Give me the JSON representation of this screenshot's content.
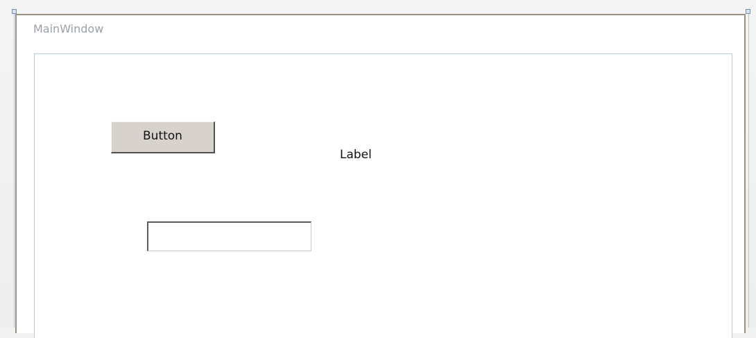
{
  "window": {
    "title": "MainWindow"
  },
  "controls": {
    "button_label": "Button",
    "label_text": "Label",
    "textbox_value": ""
  },
  "colors": {
    "frame_border": "#9b8f83",
    "client_border": "#b7cce0",
    "button_face": "#d8d2cc",
    "title_text": "#9aa0a6"
  }
}
